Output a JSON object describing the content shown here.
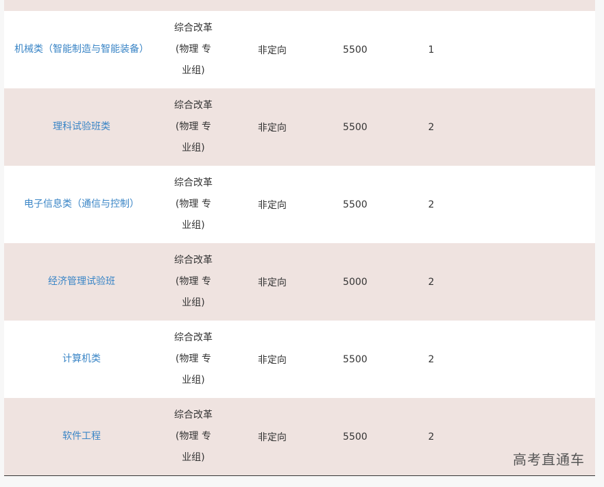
{
  "rows": [
    {
      "major": "机械类（智能制造与智能装备）",
      "type_lines": [
        "综合改革",
        "(物理 专",
        "业组)"
      ],
      "direction": "非定向",
      "fee": "5500",
      "count": "1"
    },
    {
      "major": "理科试验班类",
      "type_lines": [
        "综合改革",
        "(物理 专",
        "业组)"
      ],
      "direction": "非定向",
      "fee": "5500",
      "count": "2"
    },
    {
      "major": "电子信息类（通信与控制）",
      "type_lines": [
        "综合改革",
        "(物理 专",
        "业组)"
      ],
      "direction": "非定向",
      "fee": "5500",
      "count": "2"
    },
    {
      "major": "经济管理试验班",
      "type_lines": [
        "综合改革",
        "(物理 专",
        "业组)"
      ],
      "direction": "非定向",
      "fee": "5000",
      "count": "2"
    },
    {
      "major": "计算机类",
      "type_lines": [
        "综合改革",
        "(物理 专",
        "业组)"
      ],
      "direction": "非定向",
      "fee": "5500",
      "count": "2"
    },
    {
      "major": "软件工程",
      "type_lines": [
        "综合改革",
        "(物理 专",
        "业组)"
      ],
      "direction": "非定向",
      "fee": "5500",
      "count": "2"
    }
  ],
  "watermark": "高考直通车",
  "colors": {
    "row_alt": "#efe3e0",
    "row": "#ffffff",
    "link": "#3a85c6"
  }
}
